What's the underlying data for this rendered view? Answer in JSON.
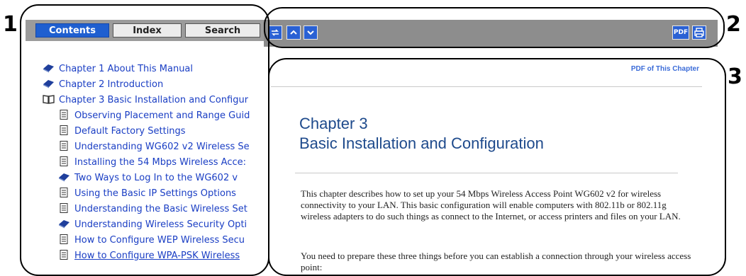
{
  "callouts": {
    "one": "1",
    "two": "2",
    "three": "3"
  },
  "tabs": [
    {
      "label": "Contents",
      "active": true
    },
    {
      "label": "Index",
      "active": false
    },
    {
      "label": "Search",
      "active": false
    }
  ],
  "toc": [
    {
      "icon": "book-closed-icon",
      "label": "Chapter 1 About This Manual"
    },
    {
      "icon": "book-closed-icon",
      "label": "Chapter 2 Introduction"
    },
    {
      "icon": "book-open-icon",
      "label": "Chapter 3 Basic Installation and Configur"
    },
    {
      "icon": "page-icon",
      "label": "Observing Placement and Range Guid"
    },
    {
      "icon": "page-icon",
      "label": "Default Factory Settings"
    },
    {
      "icon": "page-icon",
      "label": "Understanding WG602 v2 Wireless Se"
    },
    {
      "icon": "page-icon",
      "label": "Installing the 54 Mbps Wireless Acce:"
    },
    {
      "icon": "book-closed-icon",
      "label": "Two Ways to Log In to the WG602 v"
    },
    {
      "icon": "page-icon",
      "label": "Using the Basic IP Settings Options"
    },
    {
      "icon": "page-icon",
      "label": "Understanding the Basic Wireless Set"
    },
    {
      "icon": "book-closed-icon",
      "label": "Understanding Wireless Security Opti"
    },
    {
      "icon": "page-icon",
      "label": "How to Configure WEP Wireless Secu"
    },
    {
      "icon": "page-icon",
      "label": "How to Configure WPA-PSK Wireless"
    }
  ],
  "toolbar": {
    "sync_icon": "sync-icon",
    "prev_icon": "up-arrow-icon",
    "next_icon": "down-arrow-icon",
    "pdf_label": "PDF",
    "print_icon": "print-icon"
  },
  "content": {
    "pdf_link": "PDF of This Chapter",
    "chapter_number": "Chapter 3",
    "chapter_title": "Basic Installation and Configuration",
    "para1": "This chapter describes how to set up your 54 Mbps Wireless Access Point WG602 v2 for wireless connectivity to your LAN. This basic configuration will enable computers with 802.11b or 802.11g wireless adapters to do such things as connect to the Internet, or access printers and files on your LAN.",
    "para2": "You need to prepare these three things before you can establish a connection through your wireless access point:"
  },
  "colors": {
    "tab_active": "#1f5fd0",
    "link": "#1a3ec4",
    "toolbar_bg": "#8d8d8d",
    "heading": "#1e4a8c"
  }
}
